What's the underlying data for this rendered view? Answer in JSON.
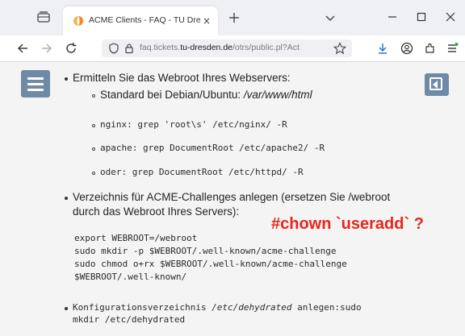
{
  "browser": {
    "tab": {
      "title": "ACME Clients - FAQ - TU Dresd",
      "close": "×"
    },
    "url": {
      "prefix": "faq.tickets.",
      "host": "tu-dresden.de",
      "path": "/otrs/public.pl?Act"
    }
  },
  "content": {
    "item1": {
      "text": "Ermitteln Sie das Webroot Ihres Webservers:",
      "sub1_label": "Standard bei Debian/Ubuntu: ",
      "sub1_path": "/var/www/html",
      "sub2": "nginx: grep 'root\\s' /etc/nginx/ -R",
      "sub3": "apache: grep DocumentRoot /etc/apache2/ -R",
      "sub4": "oder: grep DocumentRoot /etc/httpd/ -R"
    },
    "item2": {
      "line1": "Verzeichnis für ACME-Challenges anlegen (ersetzen Sie /webroot",
      "line2": "durch das Webroot Ihres Servers):"
    },
    "code": [
      "export WEBROOT=/webroot",
      "sudo mkdir -p $WEBROOT/.well-known/acme-challenge",
      "sudo chmod o+rx $WEBROOT/.well-known/acme-challenge",
      "$WEBROOT/.well-known/"
    ],
    "item3": {
      "prefix": "Konfigurationsverzeichnis ",
      "path": "/etc/dehydrated",
      "suffix": " anlegen:sudo",
      "line2": "mkdir /etc/dehydrated"
    },
    "annotation": "#chown `useradd` ?"
  },
  "colors": {
    "accent_button": "#6f8aa6",
    "annotation": "#e8261c",
    "favicon": "#f28c22"
  }
}
